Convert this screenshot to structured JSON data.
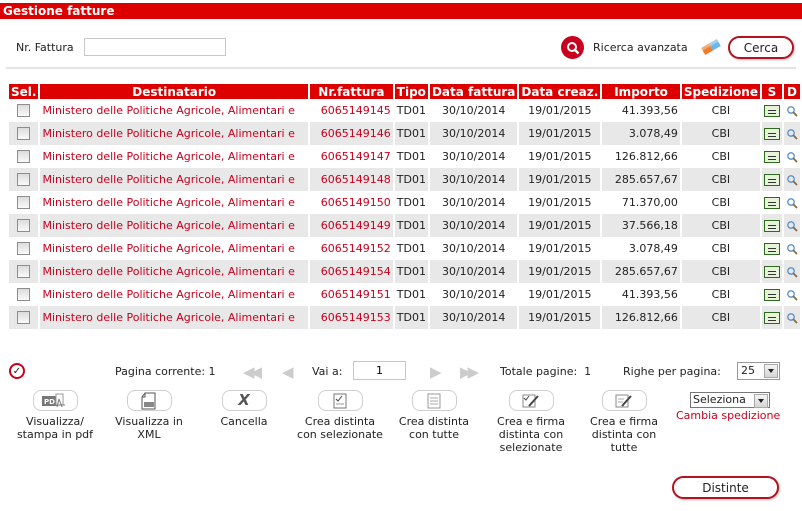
{
  "header": {
    "title": "Gestione fatture"
  },
  "search": {
    "label": "Nr. Fattura",
    "value": "",
    "placeholder": "",
    "advanced_label": "Ricerca avanzata",
    "search_button": "Cerca",
    "icons": {
      "advanced": "search-icon",
      "clear": "eraser-icon"
    }
  },
  "table": {
    "columns": [
      "Sel.",
      "Destinatario",
      "Nr.fattura",
      "Tipo",
      "Data fattura",
      "Data creaz.",
      "Importo",
      "Spedizione",
      "S",
      "D"
    ],
    "rows": [
      {
        "destinatario": "Ministero delle Politiche Agricole, Alimentari e",
        "nr": "6065149145",
        "tipo": "TD01",
        "data_fattura": "30/10/2014",
        "data_creaz": "19/01/2015",
        "importo": "41.393,56",
        "spedizione": "CBI",
        "checked": false
      },
      {
        "destinatario": "Ministero delle Politiche Agricole, Alimentari e",
        "nr": "6065149146",
        "tipo": "TD01",
        "data_fattura": "30/10/2014",
        "data_creaz": "19/01/2015",
        "importo": "3.078,49",
        "spedizione": "CBI",
        "checked": false
      },
      {
        "destinatario": "Ministero delle Politiche Agricole, Alimentari e",
        "nr": "6065149147",
        "tipo": "TD01",
        "data_fattura": "30/10/2014",
        "data_creaz": "19/01/2015",
        "importo": "126.812,66",
        "spedizione": "CBI",
        "checked": false
      },
      {
        "destinatario": "Ministero delle Politiche Agricole, Alimentari e",
        "nr": "6065149148",
        "tipo": "TD01",
        "data_fattura": "30/10/2014",
        "data_creaz": "19/01/2015",
        "importo": "285.657,67",
        "spedizione": "CBI",
        "checked": false
      },
      {
        "destinatario": "Ministero delle Politiche Agricole, Alimentari e",
        "nr": "6065149150",
        "tipo": "TD01",
        "data_fattura": "30/10/2014",
        "data_creaz": "19/01/2015",
        "importo": "71.370,00",
        "spedizione": "CBI",
        "checked": false
      },
      {
        "destinatario": "Ministero delle Politiche Agricole, Alimentari e",
        "nr": "6065149149",
        "tipo": "TD01",
        "data_fattura": "30/10/2014",
        "data_creaz": "19/01/2015",
        "importo": "37.566,18",
        "spedizione": "CBI",
        "checked": false
      },
      {
        "destinatario": "Ministero delle Politiche Agricole, Alimentari e",
        "nr": "6065149152",
        "tipo": "TD01",
        "data_fattura": "30/10/2014",
        "data_creaz": "19/01/2015",
        "importo": "3.078,49",
        "spedizione": "CBI",
        "checked": false
      },
      {
        "destinatario": "Ministero delle Politiche Agricole, Alimentari e",
        "nr": "6065149154",
        "tipo": "TD01",
        "data_fattura": "30/10/2014",
        "data_creaz": "19/01/2015",
        "importo": "285.657,67",
        "spedizione": "CBI",
        "checked": false
      },
      {
        "destinatario": "Ministero delle Politiche Agricole, Alimentari e",
        "nr": "6065149151",
        "tipo": "TD01",
        "data_fattura": "30/10/2014",
        "data_creaz": "19/01/2015",
        "importo": "41.393,56",
        "spedizione": "CBI",
        "checked": false
      },
      {
        "destinatario": "Ministero delle Politiche Agricole, Alimentari e",
        "nr": "6065149153",
        "tipo": "TD01",
        "data_fattura": "30/10/2014",
        "data_creaz": "19/01/2015",
        "importo": "126.812,66",
        "spedizione": "CBI",
        "checked": false
      }
    ]
  },
  "pager": {
    "current_label": "Pagina corrente: 1",
    "goto_label": "Vai a:",
    "goto_value": "1",
    "total_label": "Totale pagine:",
    "total_value": "1",
    "rows_label": "Righe per pagina:",
    "rows_value": "25"
  },
  "actions": [
    {
      "label1": "Visualizza/",
      "label2": "stampa in pdf",
      "label3": "",
      "icon": "pdf-icon"
    },
    {
      "label1": "Visualizza in",
      "label2": "XML",
      "label3": "",
      "icon": "xml-icon"
    },
    {
      "label1": "Cancella",
      "label2": "",
      "label3": "",
      "icon": "delete-icon"
    },
    {
      "label1": "Crea distinta",
      "label2": "con selezionate",
      "label3": "",
      "icon": "checklist-icon"
    },
    {
      "label1": "Crea distinta",
      "label2": "con tutte",
      "label3": "",
      "icon": "document-icon"
    },
    {
      "label1": "Crea e firma",
      "label2": "distinta con",
      "label3": "selezionate",
      "icon": "sign-checklist-icon"
    },
    {
      "label1": "Crea e firma",
      "label2": "distinta con",
      "label3": "tutte",
      "icon": "sign-document-icon"
    }
  ],
  "shipping": {
    "select_value": "Seleziona",
    "label": "Cambia spedizione"
  },
  "footer": {
    "distinte_button": "Distinte"
  },
  "colors": {
    "brand_red": "#dd0000",
    "link_red": "#c8001e",
    "row_alt": "#e8e8e8"
  }
}
